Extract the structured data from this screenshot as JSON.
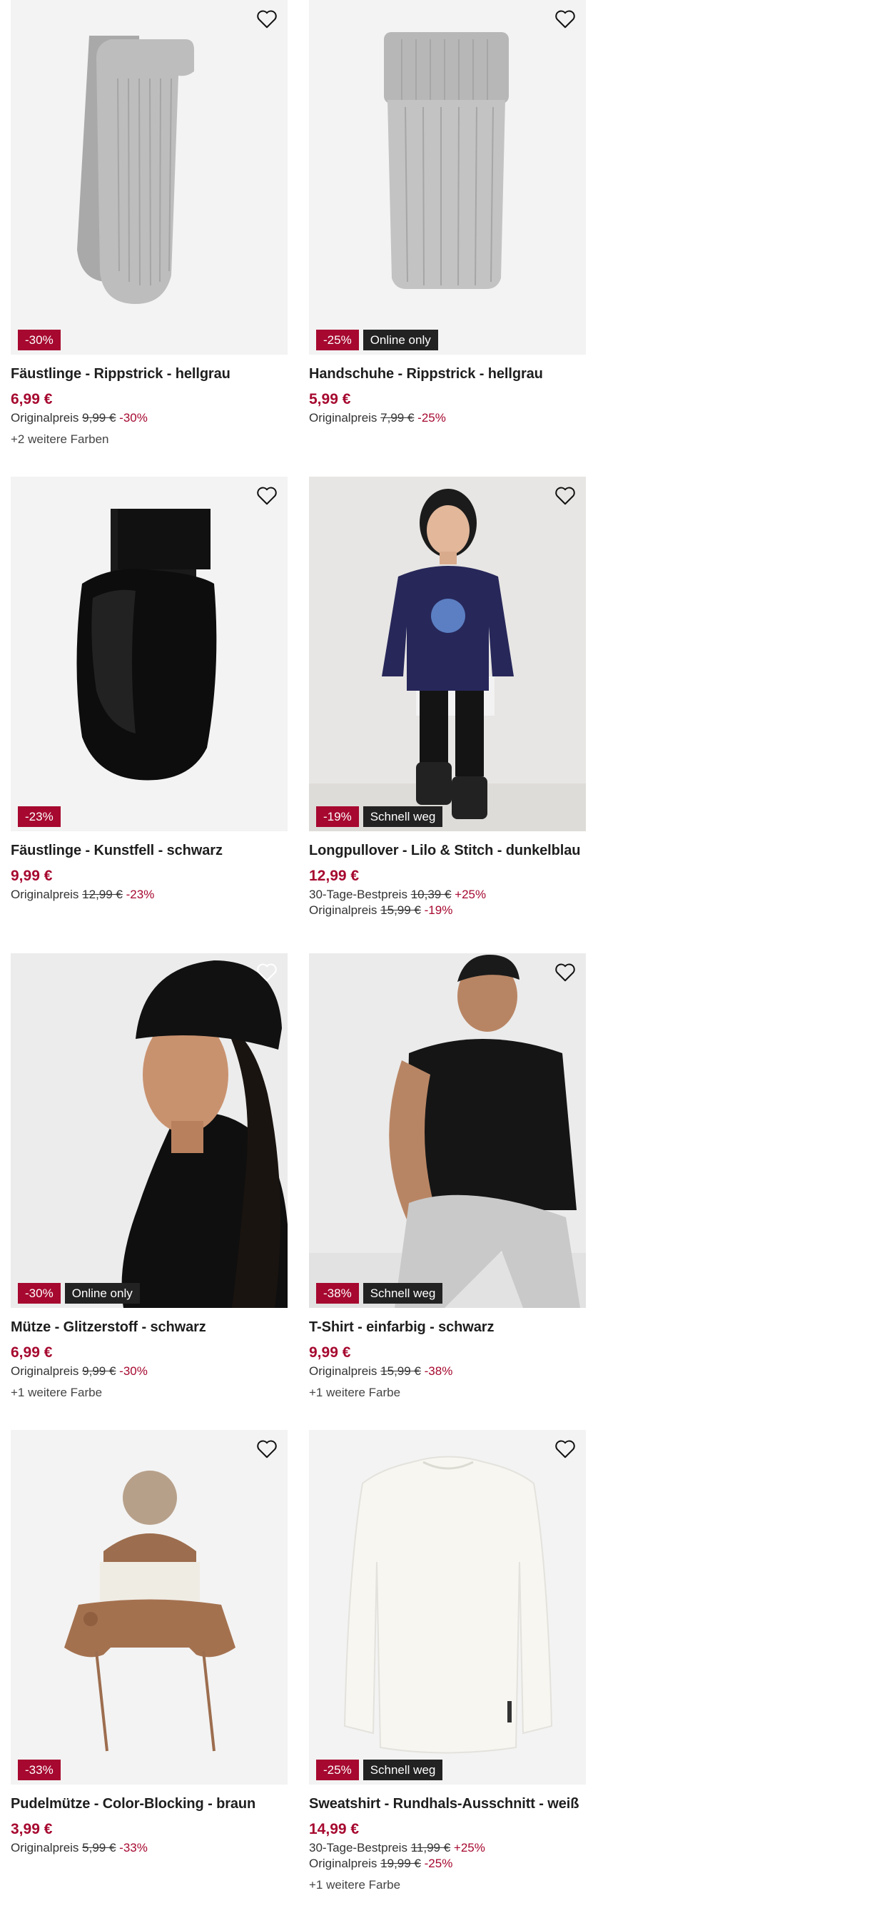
{
  "products": [
    {
      "name": "Fäustlinge - Rippstrick - hellgrau",
      "price": "6,99 €",
      "badges": {
        "discount": "-30%",
        "flag": ""
      },
      "best30": null,
      "original": {
        "label": "Originalpreis",
        "value": "9,99 €",
        "pct": "-30%"
      },
      "more_colors": "+2 weitere Farben",
      "image": "knit-mittens-grey-icon"
    },
    {
      "name": "Handschuhe - Rippstrick - hellgrau",
      "price": "5,99 €",
      "badges": {
        "discount": "-25%",
        "flag": "Online only"
      },
      "best30": null,
      "original": {
        "label": "Originalpreis",
        "value": "7,99 €",
        "pct": "-25%"
      },
      "more_colors": "",
      "image": "knit-gloves-grey-icon"
    },
    {
      "name": "Fäustlinge - Kunstfell - schwarz",
      "price": "9,99 €",
      "badges": {
        "discount": "-23%",
        "flag": ""
      },
      "best30": null,
      "original": {
        "label": "Originalpreis",
        "value": "12,99 €",
        "pct": "-23%"
      },
      "more_colors": "",
      "image": "fur-mittens-black-icon"
    },
    {
      "name": "Longpullover - Lilo & Stitch - dunkelblau",
      "price": "12,99 €",
      "badges": {
        "discount": "-19%",
        "flag": "Schnell weg"
      },
      "best30": {
        "label": "30-Tage-Bestpreis",
        "value": "10,39 €",
        "pct": "+25%"
      },
      "original": {
        "label": "Originalpreis",
        "value": "15,99 €",
        "pct": "-19%"
      },
      "more_colors": "",
      "image": "kid-longpullover-photo"
    },
    {
      "name": "Mütze - Glitzerstoff - schwarz",
      "price": "6,99 €",
      "badges": {
        "discount": "-30%",
        "flag": "Online only"
      },
      "best30": null,
      "original": {
        "label": "Originalpreis",
        "value": "9,99 €",
        "pct": "-30%"
      },
      "more_colors": "+1 weitere Farbe",
      "image": "woman-black-beanie-photo"
    },
    {
      "name": "T-Shirt - einfarbig - schwarz",
      "price": "9,99 €",
      "badges": {
        "discount": "-38%",
        "flag": "Schnell weg"
      },
      "best30": null,
      "original": {
        "label": "Originalpreis",
        "value": "15,99 €",
        "pct": "-38%"
      },
      "more_colors": "+1 weitere Farbe",
      "image": "man-black-tshirt-photo"
    },
    {
      "name": "Pudelmütze - Color-Blocking - braun",
      "price": "3,99 €",
      "badges": {
        "discount": "-33%",
        "flag": ""
      },
      "best30": null,
      "original": {
        "label": "Originalpreis",
        "value": "5,99 €",
        "pct": "-33%"
      },
      "more_colors": "",
      "image": "pompom-hat-brown-icon"
    },
    {
      "name": "Sweatshirt - Rundhals-Ausschnitt - weiß",
      "price": "14,99 €",
      "badges": {
        "discount": "-25%",
        "flag": "Schnell weg"
      },
      "best30": {
        "label": "30-Tage-Bestpreis",
        "value": "11,99 €",
        "pct": "+25%"
      },
      "original": {
        "label": "Originalpreis",
        "value": "19,99 €",
        "pct": "-25%"
      },
      "more_colors": "+1 weitere Farbe",
      "image": "white-sweatshirt-icon"
    }
  ],
  "colors": {
    "accent": "#a6082f",
    "flag_bg": "#222222",
    "text": "#1e1e1e",
    "image_bg": "#f1f1f1"
  }
}
